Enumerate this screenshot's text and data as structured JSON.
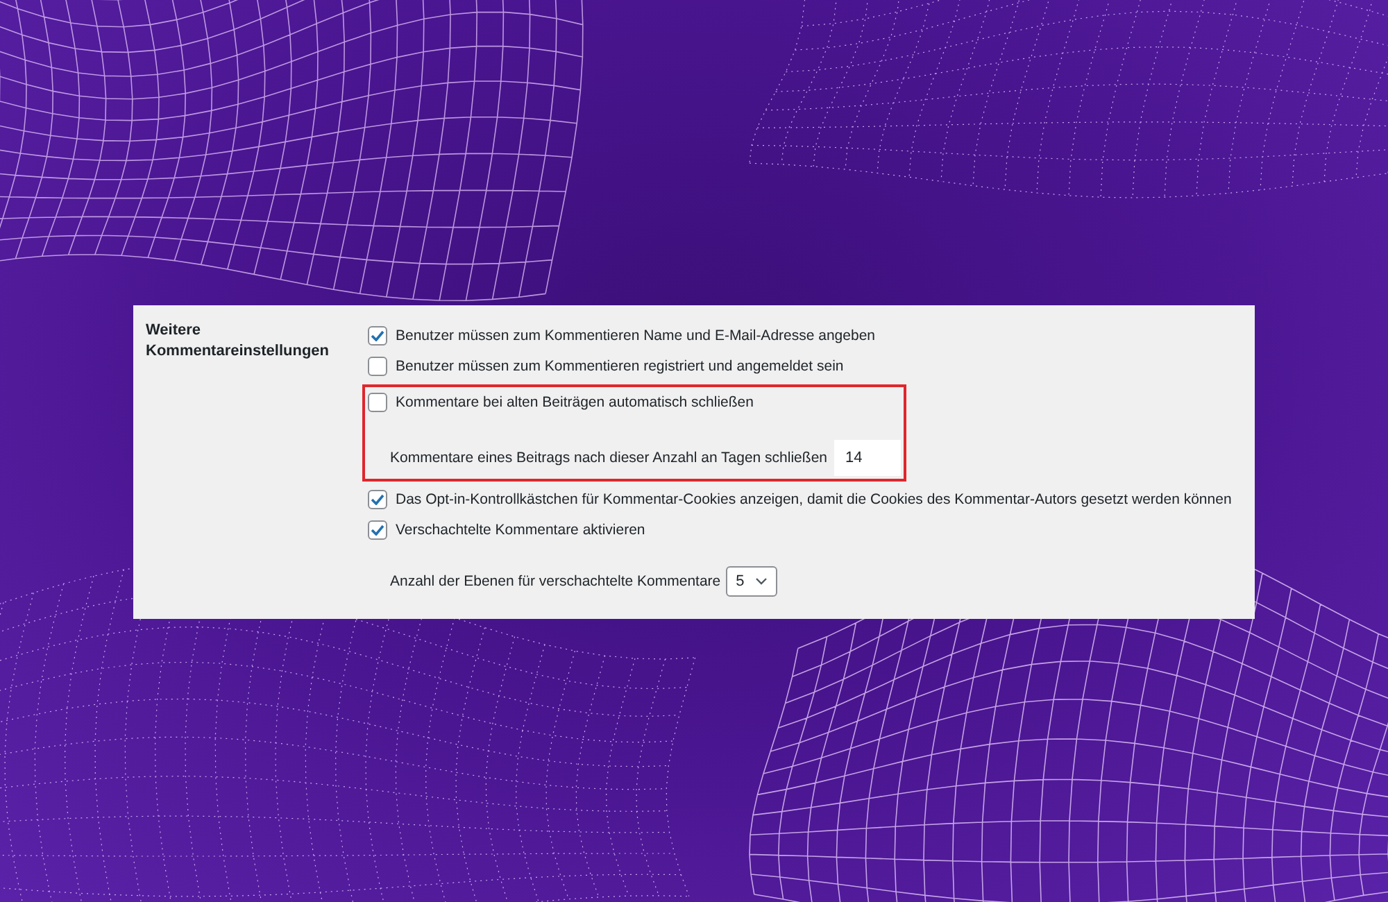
{
  "settings": {
    "label": "Weitere Kommentareinstellungen",
    "groups": [
      {
        "highlighted": false,
        "items": [
          {
            "kind": "checkbox",
            "label": "Benutzer müssen zum Kommentieren Name und E-Mail-Adresse angeben",
            "checked": true
          },
          {
            "kind": "checkbox",
            "label": "Benutzer müssen zum Kommentieren registriert und angemeldet sein",
            "checked": false
          }
        ]
      },
      {
        "highlighted": true,
        "items": [
          {
            "kind": "checkbox",
            "label": "Kommentare bei alten Beiträgen automatisch schließen",
            "checked": false
          },
          {
            "kind": "number",
            "label": "Kommentare eines Beitrags nach dieser Anzahl an Tagen schließen",
            "value": "14"
          }
        ]
      },
      {
        "highlighted": false,
        "items": [
          {
            "kind": "checkbox",
            "label": "Das Opt-in-Kontrollkästchen für Kommentar-Cookies anzeigen, damit die Cookies des Kommentar-Autors gesetzt werden können",
            "checked": true
          },
          {
            "kind": "checkbox",
            "label": "Verschachtelte Kommentare aktivieren",
            "checked": true
          },
          {
            "kind": "select",
            "label": "Anzahl der Ebenen für verschachtelte Kommentare",
            "value": "5"
          }
        ]
      }
    ]
  }
}
